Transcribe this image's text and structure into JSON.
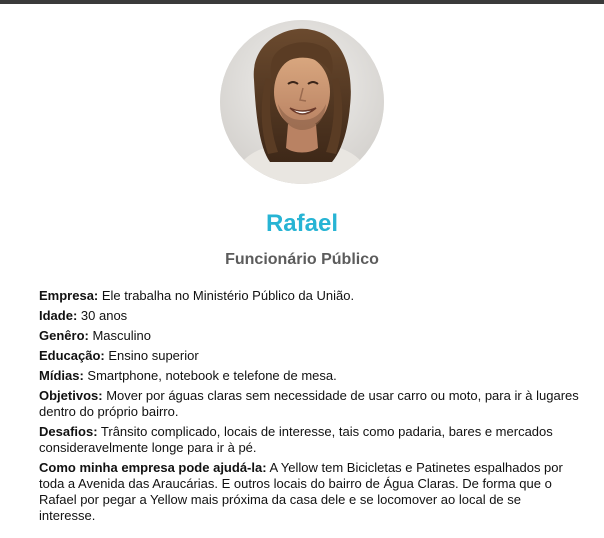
{
  "profile": {
    "name": "Rafael",
    "role": "Funcionário Público",
    "photo_icon": "person-photo"
  },
  "details": [
    {
      "label": "Empresa:",
      "value": " Ele trabalha no Ministério Público da União."
    },
    {
      "label": "Idade:",
      "value": " 30 anos"
    },
    {
      "label": "Genêro:",
      "value": " Masculino"
    },
    {
      "label": "Educação:",
      "value": " Ensino superior"
    },
    {
      "label": "Mídias:",
      "value": " Smartphone, notebook e telefone de mesa."
    },
    {
      "label": "Objetivos:",
      "value": " Mover por águas claras sem necessidade de usar carro ou moto, para ir à lugares dentro do próprio bairro."
    },
    {
      "label": "Desafios:",
      "value": " Trânsito complicado, locais de interesse, tais como padaria, bares e mercados consideravelmente longe para ir à pé."
    },
    {
      "label": "Como minha empresa pode ajudá-la:",
      "value": " A Yellow tem Bicicletas e Patinetes espalhados por toda a Avenida das Araucárias. E outros locais do bairro de Água Claras. De forma que o Rafael por pegar a Yellow mais próxima da casa dele e se locomover ao local de se interesse."
    }
  ],
  "colors": {
    "accent": "#27b4d4",
    "role_text": "#5c5c5c",
    "body_text": "#111111",
    "top_bar": "#3a3a3a"
  }
}
